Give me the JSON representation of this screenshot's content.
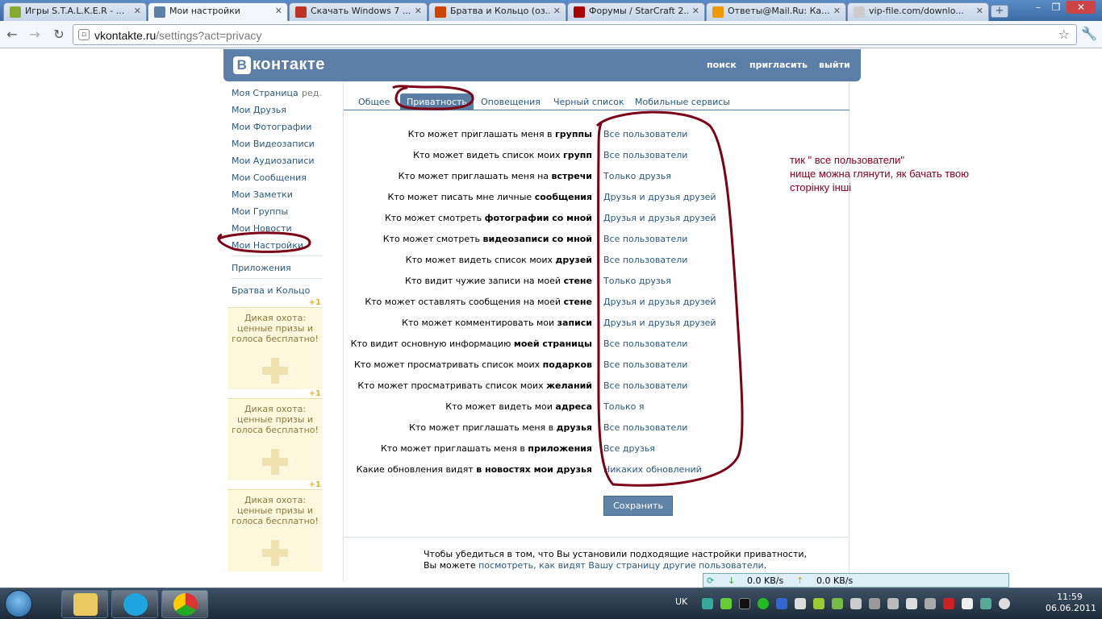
{
  "browser": {
    "tabs": [
      {
        "label": "Игры S.T.A.L.K.E.R - ...",
        "icon": "stalker-favicon-icon",
        "color": "#8a3"
      },
      {
        "label": "Мои настройки",
        "icon": "vk-favicon-icon",
        "color": "#5b7fa6",
        "active": true
      },
      {
        "label": "Скачать Windows 7 ...",
        "icon": "download-favicon-icon",
        "color": "#b32"
      },
      {
        "label": "Братва и Кольцо (оз...",
        "icon": "game-favicon-icon",
        "color": "#c40"
      },
      {
        "label": "Форумы / StarCraft 2...",
        "icon": "playground-favicon-icon",
        "color": "#a00"
      },
      {
        "label": "Ответы@Mail.Ru: Ка...",
        "icon": "mailru-favicon-icon",
        "color": "#e90"
      },
      {
        "label": "vip-file.com/downlo...",
        "icon": "page-favicon-icon",
        "color": "#ccc"
      }
    ],
    "url_host": "vkontakte.ru",
    "url_path": "/settings?act=privacy"
  },
  "header": {
    "logo_letter": "В",
    "logo_text": "контакте",
    "links": [
      "поиск",
      "пригласить",
      "выйти"
    ]
  },
  "leftnav": {
    "edit": "ред.",
    "items": [
      "Моя Страница",
      "Мои Друзья",
      "Мои Фотографии",
      "Мои Видеозаписи",
      "Мои Аудиозаписи",
      "Мои Сообщения",
      "Мои Заметки",
      "Мои Группы",
      "Мои Новости",
      "Мои Настройки"
    ],
    "apps": "Приложения",
    "app1": "Братва и Кольцо",
    "promo": {
      "plus": "+1",
      "text": "Дикая охота: ценные призы и голоса бесплатно!"
    }
  },
  "settings_tabs": [
    "Общее",
    "Приватность",
    "Оповещения",
    "Черный список",
    "Мобильные сервисы"
  ],
  "privacy_rows": [
    {
      "pre": "Кто может приглашать меня в ",
      "bold": "группы",
      "value": "Все пользователи"
    },
    {
      "pre": "Кто может видеть список моих ",
      "bold": "групп",
      "value": "Все пользователи"
    },
    {
      "pre": "Кто может приглашать меня на ",
      "bold": "встречи",
      "value": "Только друзья"
    },
    {
      "pre": "Кто может писать мне личные ",
      "bold": "сообщения",
      "value": "Друзья и друзья друзей"
    },
    {
      "pre": "Кто может смотреть ",
      "bold": "фотографии со мной",
      "value": "Друзья и друзья друзей"
    },
    {
      "pre": "Кто может смотреть ",
      "bold": "видеозаписи со мной",
      "value": "Все пользователи"
    },
    {
      "pre": "Кто может видеть список моих ",
      "bold": "друзей",
      "value": "Все пользователи"
    },
    {
      "pre": "Кто видит чужие записи на моей ",
      "bold": "стене",
      "value": "Только друзья"
    },
    {
      "pre": "Кто может оставлять сообщения на моей ",
      "bold": "стене",
      "value": "Друзья и друзья друзей"
    },
    {
      "pre": "Кто может комментировать мои ",
      "bold": "записи",
      "value": "Друзья и друзья друзей"
    },
    {
      "pre": "Кто видит основную информацию ",
      "bold": "моей страницы",
      "value": "Все пользователи"
    },
    {
      "pre": "Кто может просматривать список моих ",
      "bold": "подарков",
      "value": "Все пользователи"
    },
    {
      "pre": "Кто может просматривать список моих ",
      "bold": "желаний",
      "value": "Все пользователи"
    },
    {
      "pre": "Кто может видеть мои ",
      "bold": "адреса",
      "value": "Только я"
    },
    {
      "pre": "Кто может приглашать меня в ",
      "bold": "друзья",
      "value": "Все пользователи"
    },
    {
      "pre": "Кто может приглашать меня в ",
      "bold": "приложения",
      "value": "Все друзья"
    },
    {
      "pre": "Какие обновления видят ",
      "bold": "в новостях мои друзья",
      "value": "Никаких обновлений"
    }
  ],
  "save_label": "Сохранить",
  "bottom": {
    "line1": "Чтобы убедиться в том, что Вы установили подходящие настройки приватности,",
    "line2_pre": "Вы можете ",
    "line2_link": "посмотреть, как видят Вашу страницу другие пользователи",
    "line2_post": "."
  },
  "annotation": {
    "line1": "тик \" все пользователи\"",
    "line2": "нище можна глянути, як бачать твою",
    "line3": "сторінку інші",
    "color": "#8b0020"
  },
  "download_bar": {
    "down": "0.0 KB/s",
    "up": "0.0 KB/s"
  },
  "taskbar": {
    "lang": "UK",
    "time": "11:59",
    "date": "06.06.2011"
  }
}
